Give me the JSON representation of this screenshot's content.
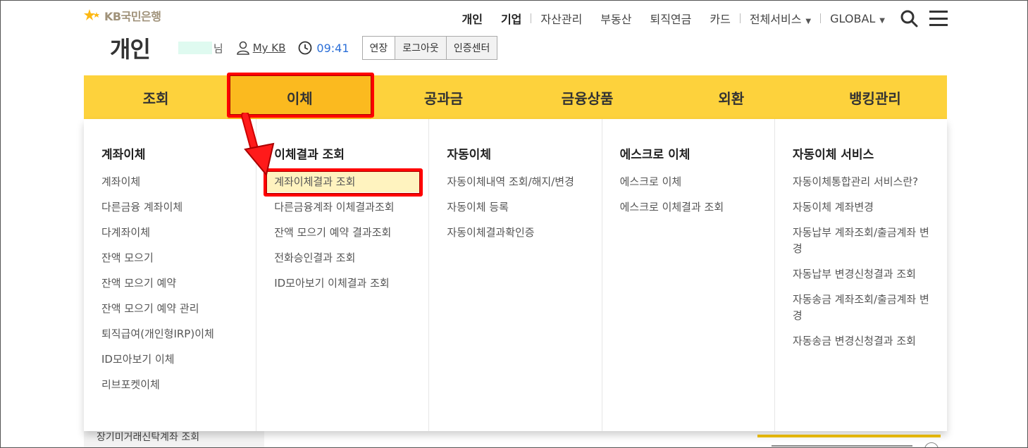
{
  "brand": {
    "logo_text": "KB국민은행"
  },
  "topnav": {
    "items": [
      {
        "label": "개인"
      },
      {
        "label": "기업"
      },
      {
        "label": "자산관리"
      },
      {
        "label": "부동산"
      },
      {
        "label": "퇴직연금"
      },
      {
        "label": "카드"
      },
      {
        "label": "전체서비스"
      },
      {
        "label": "GLOBAL"
      }
    ],
    "search_icon": "search-icon",
    "menu_icon": "hamburger-menu-icon"
  },
  "subbar": {
    "title": "개인",
    "honorific": "님",
    "mykb_label": "My KB",
    "time": "09:41",
    "buttons": [
      "연장",
      "로그아웃",
      "인증센터"
    ]
  },
  "mainnav": {
    "tabs": [
      "조회",
      "이체",
      "공과금",
      "금융상품",
      "외환",
      "뱅킹관리"
    ],
    "active_index": 1,
    "bg_color": "#fdd23c",
    "active_color": "#fbba1f"
  },
  "dropdown": {
    "columns": [
      {
        "heading": "계좌이체",
        "items": [
          "계좌이체",
          "다른금융 계좌이체",
          "다계좌이체",
          "잔액 모으기",
          "잔액 모으기 예약",
          "잔액 모으기 예약 관리",
          "퇴직급여(개인형IRP)이체",
          "ID모아보기 이체",
          "리브포켓이체"
        ]
      },
      {
        "heading": "이체결과 조회",
        "items": [
          "계좌이체결과 조회",
          "다른금융계좌 이체결과조회",
          "잔액 모으기 예약 결과조회",
          "전화승인결과 조회",
          "ID모아보기 이체결과 조회"
        ]
      },
      {
        "heading": "자동이체",
        "items": [
          "자동이체내역 조회/해지/변경",
          "자동이체 등록",
          "자동이체결과확인증"
        ]
      },
      {
        "heading": "에스크로 이체",
        "items": [
          "에스크로 이체",
          "에스크로 이체결과 조회"
        ]
      },
      {
        "heading": "자동이체 서비스",
        "items": [
          "자동이체통합관리 서비스란?",
          "자동이체 계좌변경",
          "자동납부 계좌조회/출금계좌 변경",
          "자동납부 변경신청결과 조회",
          "자동송금 계좌조회/출금계좌 변경",
          "자동송금 변경신청결과 조회"
        ]
      }
    ]
  },
  "bottom": {
    "left_text": "장기미거래신탁계좌 조회"
  },
  "annotation_color": "#ff0000"
}
